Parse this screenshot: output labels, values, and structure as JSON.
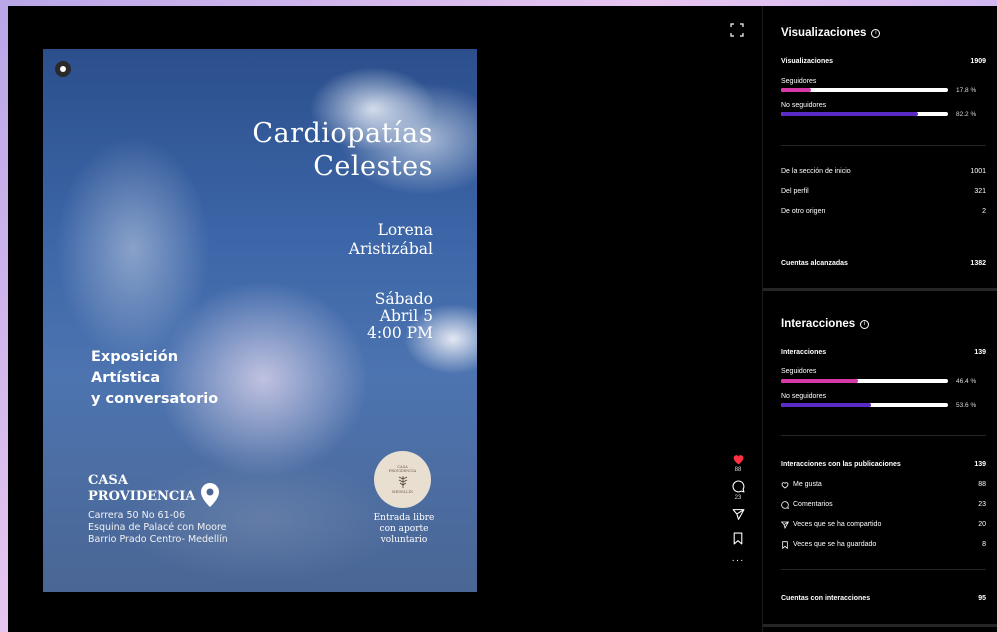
{
  "poster": {
    "title_line1": "Cardiopatías",
    "title_line2": "Celestes",
    "author_line1": "Lorena",
    "author_line2": "Aristizábal",
    "date_line1": "Sábado",
    "date_line2": "Abril 5",
    "date_line3": "4:00 PM",
    "expo_line1": "Exposición",
    "expo_line2": "Artística",
    "expo_line3": "y conversatorio",
    "venue_line1": "CASA",
    "venue_line2": "PROVIDENCIA",
    "addr_line1": "Carrera 50 No 61-06",
    "addr_line2": "Esquina de Palacé con Moore",
    "addr_line3": "Barrio Prado Centro- Medellín",
    "logo_line1": "CASA",
    "logo_line2": "PROVIDENCIA",
    "logo_line3": "MEDELLÍN",
    "entry_line1": "Entrada libre",
    "entry_line2": "con aporte",
    "entry_line3": "voluntario"
  },
  "actions": {
    "likes": "88",
    "comments": "23",
    "more": "···"
  },
  "views": {
    "title": "Visualizaciones",
    "info": "i",
    "total_label": "Visualizaciones",
    "total_value": "1909",
    "followers_label": "Seguidores",
    "followers_pct": "17.8 %",
    "followers_fraction": 0.178,
    "nonfollowers_label": "No seguidores",
    "nonfollowers_pct": "82.2 %",
    "nonfollowers_fraction": 0.822,
    "sources": [
      {
        "label": "De la sección de inicio",
        "value": "1001"
      },
      {
        "label": "Del perfil",
        "value": "321"
      },
      {
        "label": "De otro origen",
        "value": "2"
      }
    ],
    "reach_label": "Cuentas alcanzadas",
    "reach_value": "1382"
  },
  "interactions": {
    "title": "Interacciones",
    "info": "i",
    "total_label": "Interacciones",
    "total_value": "139",
    "followers_label": "Seguidores",
    "followers_pct": "46.4 %",
    "followers_fraction": 0.464,
    "nonfollowers_label": "No seguidores",
    "nonfollowers_pct": "53.6 %",
    "nonfollowers_fraction": 0.536,
    "posts_label": "Interacciones con las publicaciones",
    "posts_value": "139",
    "breakdown": [
      {
        "label": "Me gusta",
        "value": "88",
        "icon": "heart-icon"
      },
      {
        "label": "Comentarios",
        "value": "23",
        "icon": "comment-icon"
      },
      {
        "label": "Veces que se ha compartido",
        "value": "20",
        "icon": "share-icon"
      },
      {
        "label": "Veces que se ha guardado",
        "value": "8",
        "icon": "bookmark-icon"
      }
    ],
    "accounts_label": "Cuentas con interacciones",
    "accounts_value": "95"
  },
  "colors": {
    "followers_bar": "#d63aa8",
    "nonfollowers_bar": "#5a2bc4",
    "like": "#ff3040"
  }
}
